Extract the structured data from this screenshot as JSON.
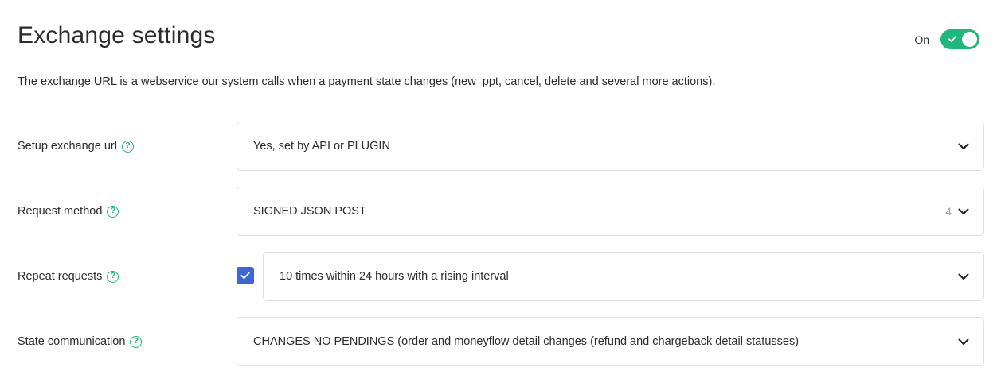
{
  "header": {
    "title": "Exchange settings",
    "toggle_label": "On",
    "toggle_state": "on",
    "accent_color": "#1db87a"
  },
  "description": "The exchange URL is a webservice our system calls when a payment state changes (new_ppt, cancel, delete and several more actions).",
  "fields": {
    "setup_exchange_url": {
      "label": "Setup exchange url",
      "value": "Yes, set by API or PLUGIN",
      "help_icon": "question-circle-icon"
    },
    "request_method": {
      "label": "Request method",
      "value": "SIGNED JSON POST",
      "count": "4",
      "help_icon": "question-circle-icon"
    },
    "repeat_requests": {
      "label": "Repeat requests",
      "enabled": true,
      "value": "10 times within 24 hours with a rising interval",
      "help_icon": "question-circle-icon",
      "checkbox_color": "#3d67d6"
    },
    "state_communication": {
      "label": "State communication",
      "value": "CHANGES NO PENDINGS (order and moneyflow detail changes (refund and chargeback detail statusses)",
      "help_icon": "question-circle-icon"
    }
  }
}
